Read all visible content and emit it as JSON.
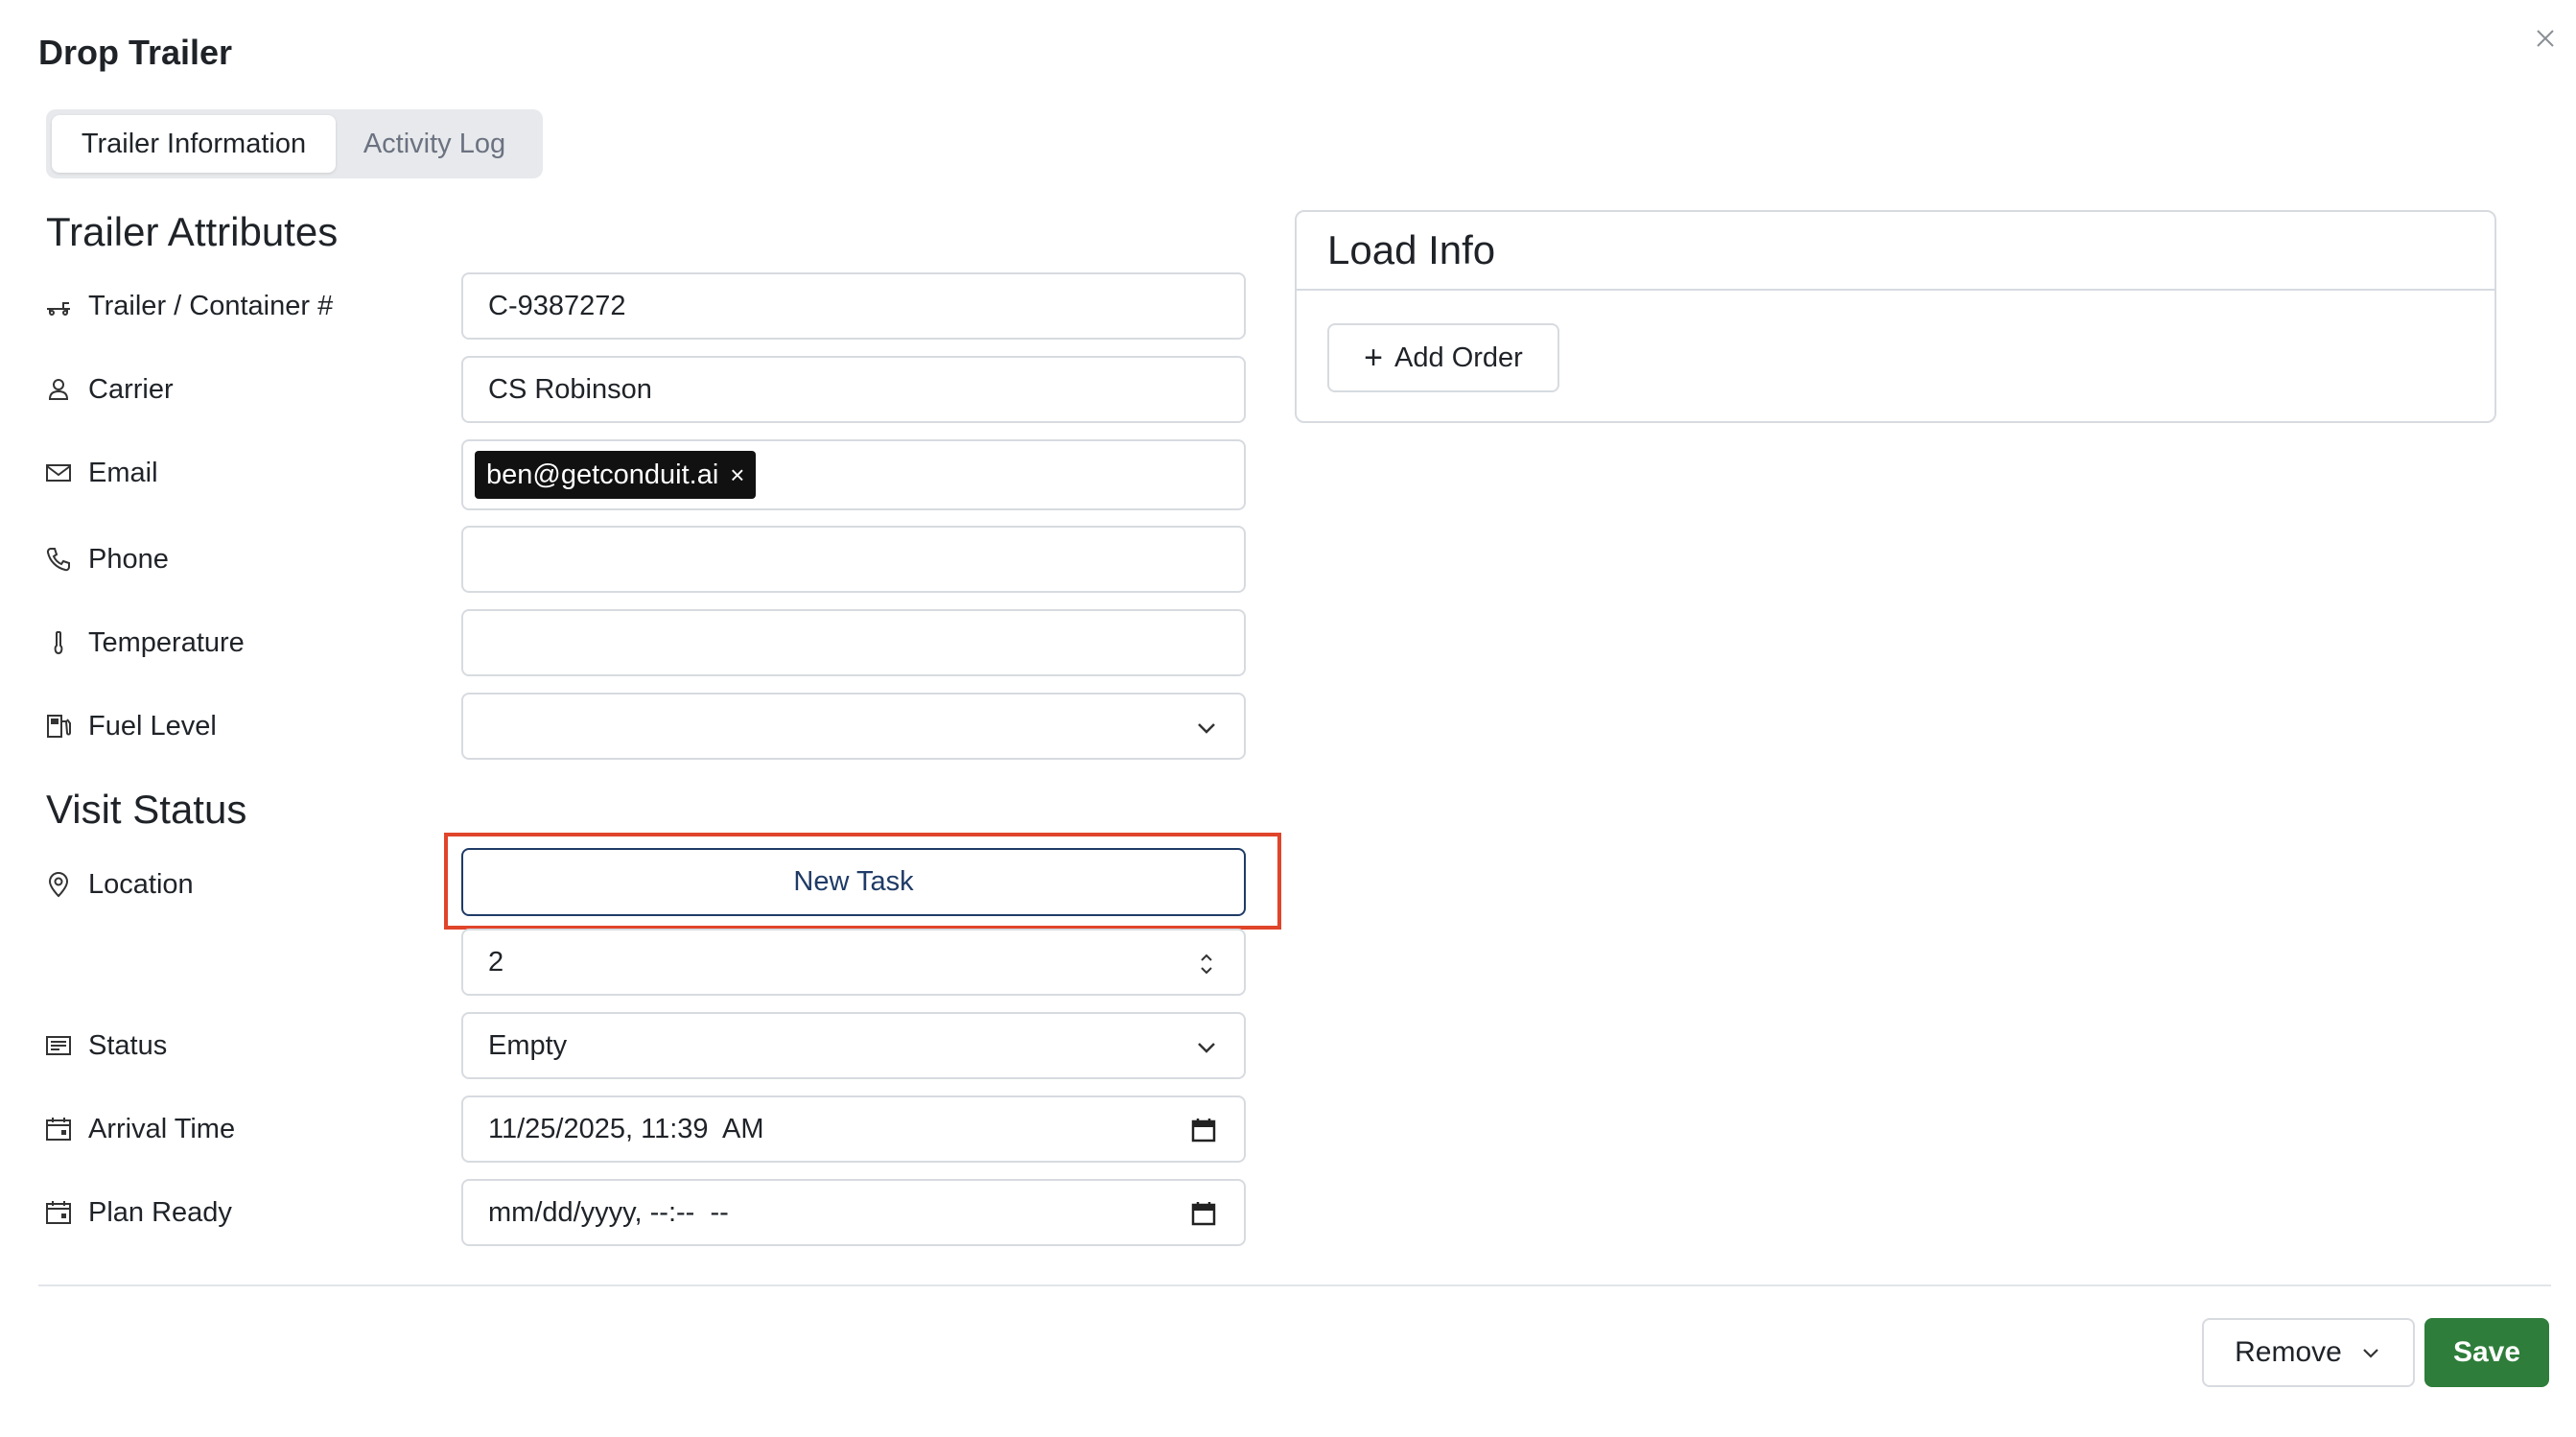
{
  "dialog": {
    "title": "Drop Trailer"
  },
  "tabs": [
    {
      "label": "Trailer Information",
      "active": true
    },
    {
      "label": "Activity Log",
      "active": false
    }
  ],
  "trailer_attributes": {
    "title": "Trailer Attributes",
    "fields": {
      "trailer": {
        "label": "Trailer / Container #",
        "value": "C-9387272",
        "icon": "trailer-icon"
      },
      "carrier": {
        "label": "Carrier",
        "value": "CS Robinson",
        "icon": "user-icon"
      },
      "email": {
        "label": "Email",
        "chip": "ben@getconduit.ai",
        "chip_remove": "×",
        "icon": "mail-icon"
      },
      "phone": {
        "label": "Phone",
        "value": "",
        "icon": "phone-icon"
      },
      "temperature": {
        "label": "Temperature",
        "value": "",
        "icon": "thermometer-icon"
      },
      "fuel": {
        "label": "Fuel Level",
        "value": "",
        "icon": "fuel-icon"
      }
    }
  },
  "visit_status": {
    "title": "Visit Status",
    "fields": {
      "location": {
        "label": "Location",
        "button": "New Task",
        "icon": "map-pin-icon"
      },
      "location_number": {
        "value": "2"
      },
      "status": {
        "label": "Status",
        "value": "Empty",
        "icon": "status-icon"
      },
      "arrival": {
        "label": "Arrival Time",
        "value": "11/25/2025, 11:39  AM",
        "icon": "calendar-icon"
      },
      "plan_ready": {
        "label": "Plan Ready",
        "value": "mm/dd/yyyy, --:--  --",
        "icon": "calendar-icon"
      }
    }
  },
  "load_info": {
    "title": "Load Info",
    "add_order_label": "Add Order",
    "add_order_plus": "+"
  },
  "footer": {
    "remove_label": "Remove",
    "save_label": "Save"
  },
  "colors": {
    "accent_navy": "#1f3b66",
    "save_green": "#2e7d3a",
    "highlight": "#e0452b"
  }
}
